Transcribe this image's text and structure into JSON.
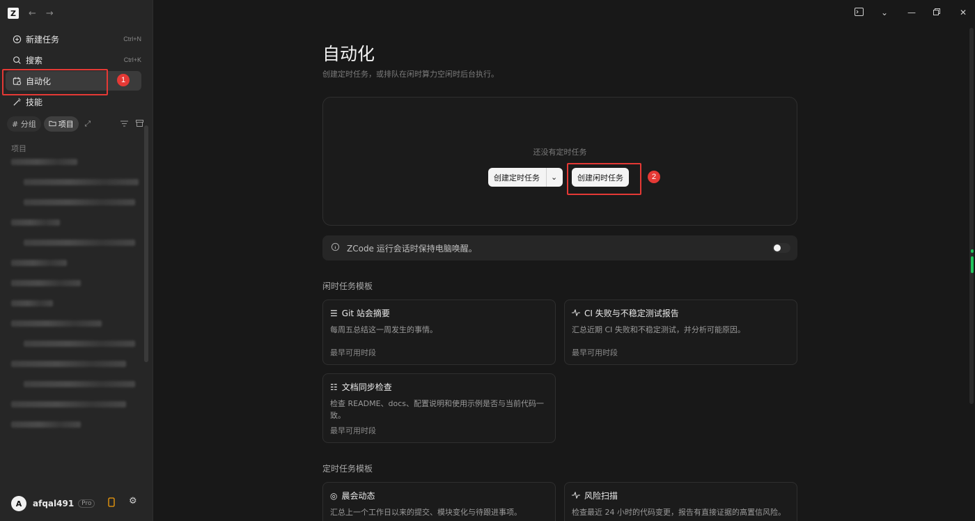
{
  "app": {
    "logo_letter": "Z"
  },
  "sidebar": {
    "nav": [
      {
        "label": "新建任务",
        "shortcut": "Ctrl+N",
        "icon": "plus-circle-icon"
      },
      {
        "label": "搜索",
        "shortcut": "Ctrl+K",
        "icon": "search-icon"
      },
      {
        "label": "自动化",
        "shortcut": "",
        "icon": "calendar-clock-icon"
      },
      {
        "label": "技能",
        "shortcut": "",
        "icon": "wand-icon"
      }
    ],
    "filters": {
      "group": "# 分组",
      "project": "项目"
    },
    "projects_label": "项目",
    "user": {
      "initial": "A",
      "name": "afqal491",
      "plan": "Pro"
    }
  },
  "annotations": {
    "badge1": "1",
    "badge2": "2"
  },
  "main": {
    "title": "自动化",
    "subtitle": "创建定时任务，或排队在闲时算力空闲时后台执行。",
    "empty_text": "还没有定时任务",
    "create_scheduled_button": "创建定时任务",
    "create_idle_button": "创建闲时任务",
    "keep_awake_text": "ZCode 运行会话时保持电脑唤醒。",
    "keep_awake_on": true,
    "idle_templates_title": "闲时任务模板",
    "idle_templates": [
      {
        "title": "Git 站会摘要",
        "desc": "每周五总结这一周发生的事情。",
        "when": "最早可用时段"
      },
      {
        "title": "CI 失败与不稳定测试报告",
        "desc": "汇总近期 CI 失败和不稳定测试，并分析可能原因。",
        "when": "最早可用时段"
      },
      {
        "title": "文档同步检查",
        "desc": "检查 README、docs、配置说明和使用示例是否与当前代码一致。",
        "when": "最早可用时段"
      }
    ],
    "scheduled_templates_title": "定时任务模板",
    "scheduled_templates": [
      {
        "title": "晨会动态",
        "desc": "汇总上一个工作日以来的提交、模块变化与待跟进事项。"
      },
      {
        "title": "风险扫描",
        "desc": "检查最近 24 小时的代码变更，报告有直接证据的高置信风险。"
      }
    ]
  }
}
